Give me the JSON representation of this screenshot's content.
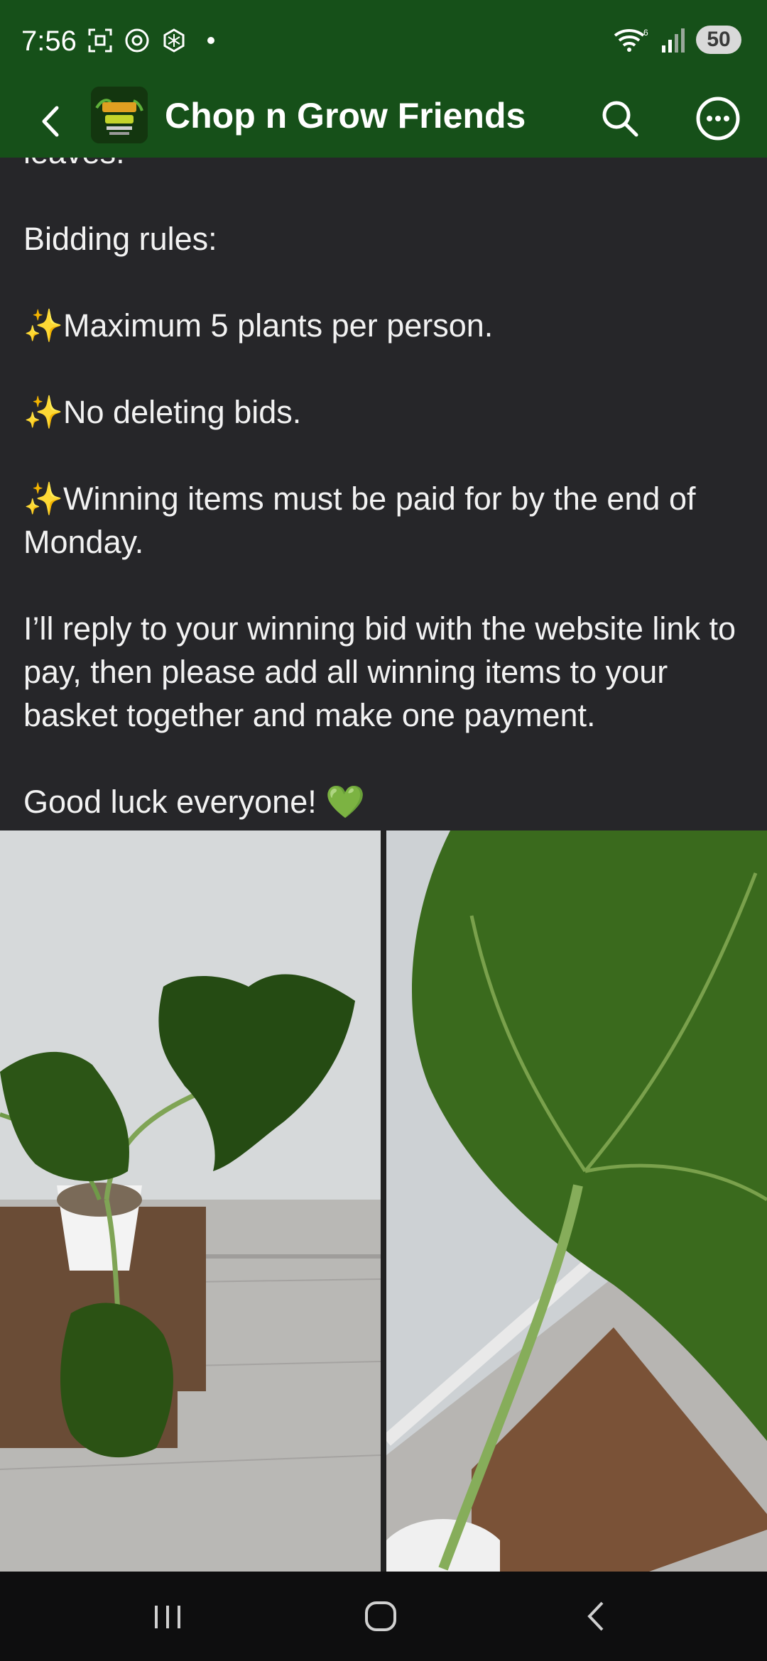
{
  "status_bar": {
    "time": "7:56",
    "battery": "50",
    "icons": [
      "screenshot-icon",
      "threads-icon",
      "chatgpt-icon",
      "notification-dot-icon",
      "wifi-icon",
      "signal-icon"
    ]
  },
  "app_bar": {
    "group_name": "Chop n Grow Friends",
    "avatar_text": "Chop n Grow Friends",
    "icons": [
      "back-arrow-icon",
      "search-icon",
      "more-icon"
    ]
  },
  "post": {
    "partial_top_line": "leaves.",
    "bidding_heading": "Bidding rules:",
    "rule_1": "✨Maximum 5 plants per person.",
    "rule_2": "✨No deleting bids.",
    "rule_3": "✨Winning items must be paid for by the end of Monday.",
    "payment_note": "I’ll reply to your winning bid with the website link to pay, then please add all winning items to your basket together and make one payment.",
    "closing": "Good luck everyone! 💚"
  },
  "nav_bar": {
    "icons": [
      "recent-apps-icon",
      "home-icon",
      "back-icon"
    ]
  },
  "colors": {
    "header_green": "#165019",
    "post_background": "#262629",
    "nav_background": "#0e0e0f"
  }
}
